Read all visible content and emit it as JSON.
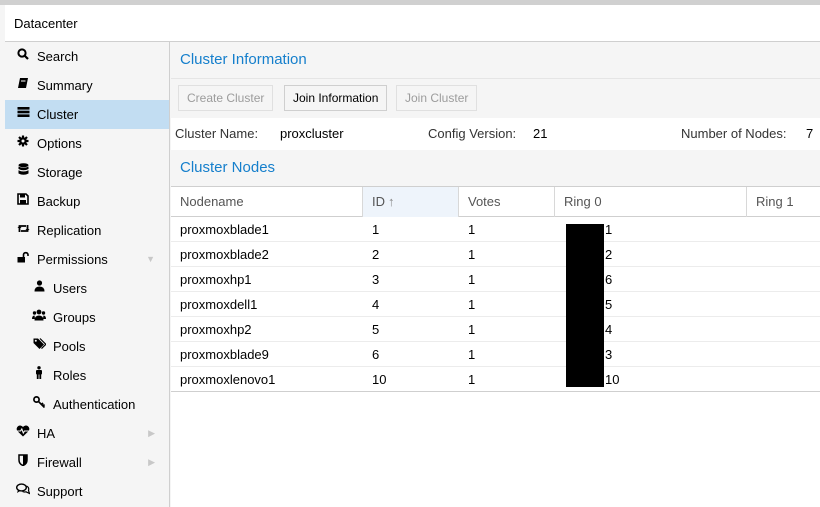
{
  "header": {
    "title": "Datacenter"
  },
  "sidebar": {
    "items": [
      {
        "label": "Search",
        "icon": "search-icon"
      },
      {
        "label": "Summary",
        "icon": "book-icon"
      },
      {
        "label": "Cluster",
        "icon": "server-icon"
      },
      {
        "label": "Options",
        "icon": "gear-icon"
      },
      {
        "label": "Storage",
        "icon": "database-icon"
      },
      {
        "label": "Backup",
        "icon": "floppy-icon"
      },
      {
        "label": "Replication",
        "icon": "retweet-icon"
      },
      {
        "label": "Permissions",
        "icon": "unlock-icon"
      },
      {
        "label": "Users",
        "icon": "user-icon"
      },
      {
        "label": "Groups",
        "icon": "users-icon"
      },
      {
        "label": "Pools",
        "icon": "tags-icon"
      },
      {
        "label": "Roles",
        "icon": "male-icon"
      },
      {
        "label": "Authentication",
        "icon": "key-icon"
      },
      {
        "label": "HA",
        "icon": "heartbeat-icon"
      },
      {
        "label": "Firewall",
        "icon": "shield-icon"
      },
      {
        "label": "Support",
        "icon": "comments-icon"
      }
    ]
  },
  "main": {
    "title": "Cluster Information",
    "buttons": {
      "create": "Create Cluster",
      "join_info": "Join Information",
      "join": "Join Cluster"
    },
    "info": {
      "name_label": "Cluster Name:",
      "name_value": "proxcluster",
      "version_label": "Config Version:",
      "version_value": "21",
      "nodes_label": "Number of Nodes:",
      "nodes_value": "7"
    },
    "nodes_title": "Cluster Nodes",
    "columns": {
      "nodename": "Nodename",
      "id": "ID",
      "votes": "Votes",
      "ring0": "Ring 0",
      "ring1": "Ring 1"
    },
    "rows": [
      {
        "name": "proxmoxblade1",
        "id": "1",
        "votes": "1",
        "ring0": "1"
      },
      {
        "name": "proxmoxblade2",
        "id": "2",
        "votes": "1",
        "ring0": "2"
      },
      {
        "name": "proxmoxhp1",
        "id": "3",
        "votes": "1",
        "ring0": "6"
      },
      {
        "name": "proxmoxdell1",
        "id": "4",
        "votes": "1",
        "ring0": "5"
      },
      {
        "name": "proxmoxhp2",
        "id": "5",
        "votes": "1",
        "ring0": "4"
      },
      {
        "name": "proxmoxblade9",
        "id": "6",
        "votes": "1",
        "ring0": "3"
      },
      {
        "name": "proxmoxlenovo1",
        "id": "10",
        "votes": "1",
        "ring0": "10"
      }
    ]
  }
}
